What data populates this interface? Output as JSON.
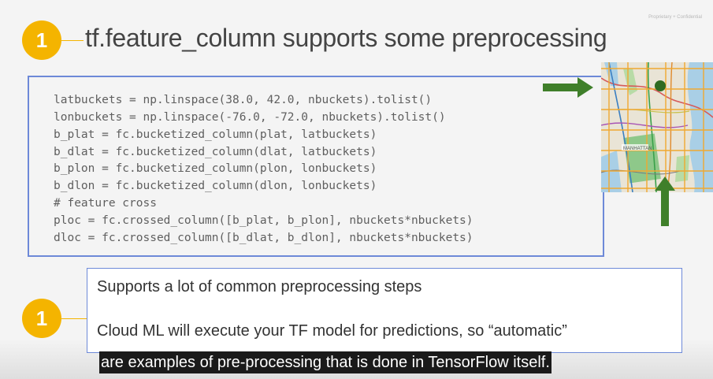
{
  "watermark": "Proprietary + Confidential",
  "badges": {
    "top": "1",
    "bottom": "1"
  },
  "title": "tf.feature_column supports some preprocessing",
  "code_lines": [
    "latbuckets = np.linspace(38.0, 42.0, nbuckets).tolist()",
    "lonbuckets = np.linspace(-76.0, -72.0, nbuckets).tolist()",
    "b_plat = fc.bucketized_column(plat, latbuckets)",
    "b_dlat = fc.bucketized_column(dlat, latbuckets)",
    "b_plon = fc.bucketized_column(plon, lonbuckets)",
    "b_dlon = fc.bucketized_column(dlon, lonbuckets)",
    "# feature cross",
    "ploc = fc.crossed_column([b_plat, b_plon], nbuckets*nbuckets)",
    "dloc = fc.crossed_column([b_dlat, b_dlon], nbuckets*nbuckets)"
  ],
  "info": {
    "line1": "Supports a lot of common preprocessing steps",
    "line2": "Cloud ML will execute your TF model for predictions, so “automatic”"
  },
  "map": {
    "label": "MANHATTAN"
  },
  "caption": "are examples of pre-processing that is done in TensorFlow itself.",
  "colors": {
    "badge": "#f4b400",
    "box_border": "#6d89d8",
    "arrow": "#3f7f2a",
    "map_grid": "#f0a830"
  },
  "icons": [
    "right-arrow-icon",
    "up-arrow-icon",
    "location-pin-icon"
  ]
}
